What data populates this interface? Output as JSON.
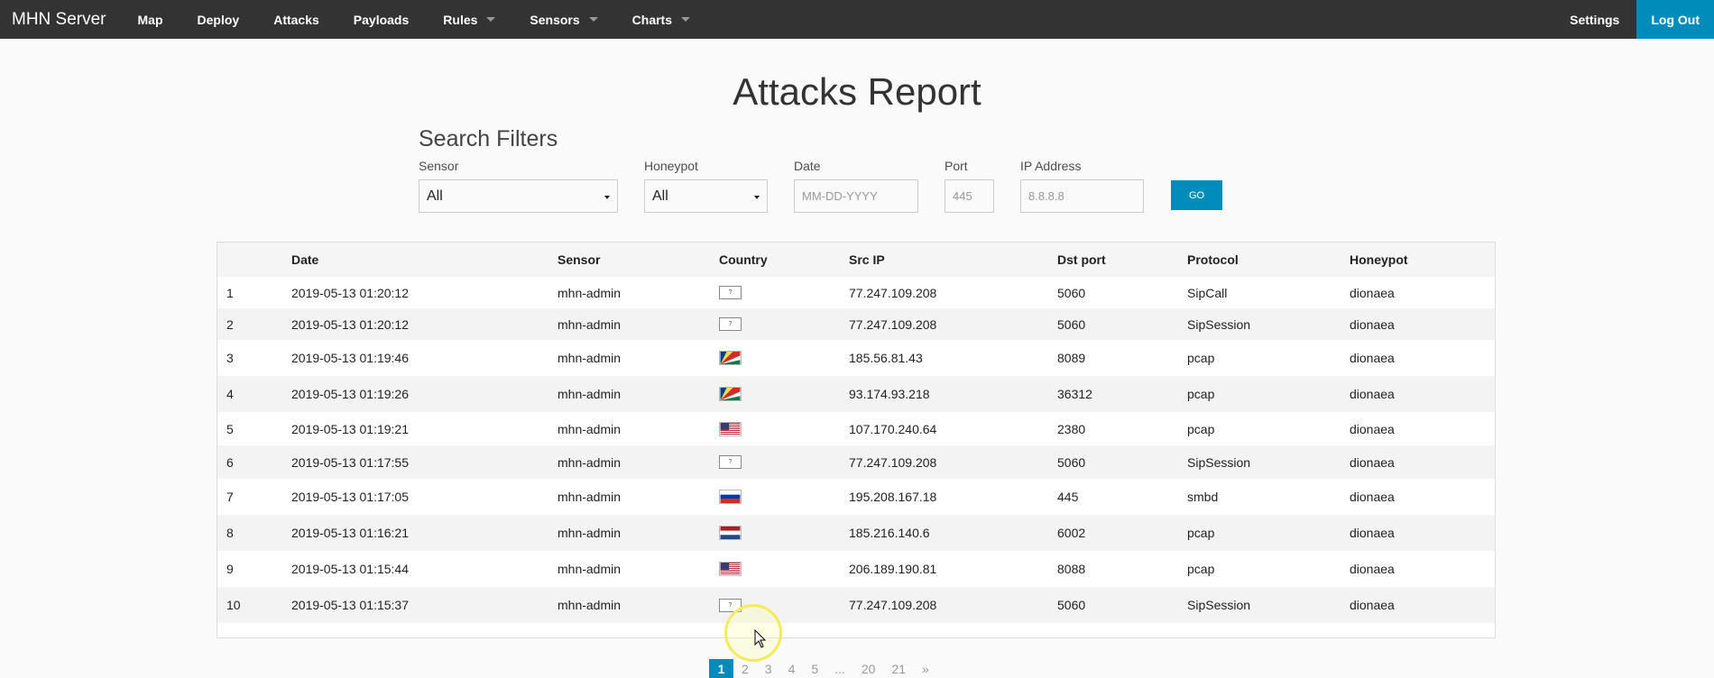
{
  "nav": {
    "brand": "MHN Server",
    "items": [
      {
        "label": "Map",
        "dropdown": false
      },
      {
        "label": "Deploy",
        "dropdown": false
      },
      {
        "label": "Attacks",
        "dropdown": false
      },
      {
        "label": "Payloads",
        "dropdown": false
      },
      {
        "label": "Rules",
        "dropdown": true
      },
      {
        "label": "Sensors",
        "dropdown": true
      },
      {
        "label": "Charts",
        "dropdown": true
      }
    ],
    "settings": "Settings",
    "logout": "Log Out"
  },
  "page_title": "Attacks Report",
  "filters": {
    "title": "Search Filters",
    "sensor": {
      "label": "Sensor",
      "value": "All"
    },
    "honeypot": {
      "label": "Honeypot",
      "value": "All"
    },
    "date": {
      "label": "Date",
      "placeholder": "MM-DD-YYYY"
    },
    "port": {
      "label": "Port",
      "placeholder": "445"
    },
    "ip": {
      "label": "IP Address",
      "placeholder": "8.8.8.8"
    },
    "go": "GO"
  },
  "table": {
    "headers": [
      "",
      "Date",
      "Sensor",
      "Country",
      "Src IP",
      "Dst port",
      "Protocol",
      "Honeypot"
    ],
    "rows": [
      {
        "n": "1",
        "date": "2019-05-13 01:20:12",
        "sensor": "mhn-admin",
        "flag": "unknown",
        "src_ip": "77.247.109.208",
        "dst_port": "5060",
        "protocol": "SipCall",
        "honeypot": "dionaea"
      },
      {
        "n": "2",
        "date": "2019-05-13 01:20:12",
        "sensor": "mhn-admin",
        "flag": "unknown",
        "src_ip": "77.247.109.208",
        "dst_port": "5060",
        "protocol": "SipSession",
        "honeypot": "dionaea"
      },
      {
        "n": "3",
        "date": "2019-05-13 01:19:46",
        "sensor": "mhn-admin",
        "flag": "seychelles",
        "src_ip": "185.56.81.43",
        "dst_port": "8089",
        "protocol": "pcap",
        "honeypot": "dionaea"
      },
      {
        "n": "4",
        "date": "2019-05-13 01:19:26",
        "sensor": "mhn-admin",
        "flag": "seychelles",
        "src_ip": "93.174.93.218",
        "dst_port": "36312",
        "protocol": "pcap",
        "honeypot": "dionaea"
      },
      {
        "n": "5",
        "date": "2019-05-13 01:19:21",
        "sensor": "mhn-admin",
        "flag": "usa",
        "src_ip": "107.170.240.64",
        "dst_port": "2380",
        "protocol": "pcap",
        "honeypot": "dionaea"
      },
      {
        "n": "6",
        "date": "2019-05-13 01:17:55",
        "sensor": "mhn-admin",
        "flag": "unknown",
        "src_ip": "77.247.109.208",
        "dst_port": "5060",
        "protocol": "SipSession",
        "honeypot": "dionaea"
      },
      {
        "n": "7",
        "date": "2019-05-13 01:17:05",
        "sensor": "mhn-admin",
        "flag": "russia",
        "src_ip": "195.208.167.18",
        "dst_port": "445",
        "protocol": "smbd",
        "honeypot": "dionaea"
      },
      {
        "n": "8",
        "date": "2019-05-13 01:16:21",
        "sensor": "mhn-admin",
        "flag": "netherlands",
        "src_ip": "185.216.140.6",
        "dst_port": "6002",
        "protocol": "pcap",
        "honeypot": "dionaea"
      },
      {
        "n": "9",
        "date": "2019-05-13 01:15:44",
        "sensor": "mhn-admin",
        "flag": "usa",
        "src_ip": "206.189.190.81",
        "dst_port": "8088",
        "protocol": "pcap",
        "honeypot": "dionaea"
      },
      {
        "n": "10",
        "date": "2019-05-13 01:15:37",
        "sensor": "mhn-admin",
        "flag": "unknown",
        "src_ip": "77.247.109.208",
        "dst_port": "5060",
        "protocol": "SipSession",
        "honeypot": "dionaea"
      }
    ],
    "unknown_flag_text": "?"
  },
  "pagination": [
    "1",
    "2",
    "3",
    "4",
    "5",
    "...",
    "20",
    "21",
    "»"
  ],
  "colors": {
    "navbar": "#333333",
    "accent": "#008cba"
  }
}
